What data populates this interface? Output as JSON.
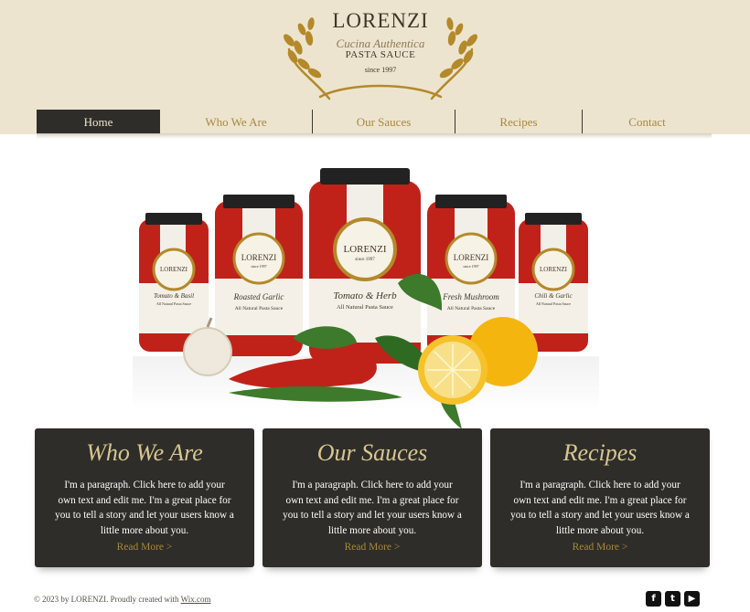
{
  "logo": {
    "brand": "LORENZI",
    "tagline": "Cucina Authentica",
    "product": "PASTA SAUCE",
    "since": "since 1997"
  },
  "nav": {
    "items": [
      {
        "label": "Home",
        "active": true
      },
      {
        "label": "Who We Are",
        "active": false
      },
      {
        "label": "Our Sauces",
        "active": false
      },
      {
        "label": "Recipes",
        "active": false
      },
      {
        "label": "Contact",
        "active": false
      }
    ]
  },
  "hero": {
    "jars": [
      {
        "brand": "LORENZI",
        "flavor": "Tomato & Basil"
      },
      {
        "brand": "LORENZI",
        "flavor": "Roasted Garlic"
      },
      {
        "brand": "LORENZI",
        "flavor": "Tomato & Herb"
      },
      {
        "brand": "LORENZI",
        "flavor": "Fresh Mushroom"
      },
      {
        "brand": "LORENZI",
        "flavor": "Chili & Garlic"
      }
    ],
    "jar_subtitle": "All Natural Pasta Sauce",
    "jar_since": "since 1997"
  },
  "cards": [
    {
      "title": "Who We Are",
      "text": "I'm a paragraph. Click here to add your own text and edit me. I'm a great place for you to tell a story and let your users know a little more about you.",
      "link": "Read More >"
    },
    {
      "title": "Our Sauces",
      "text": "I'm a paragraph. Click here to add your own text and edit me. I'm a great place for you to tell a story and let your users know a little more about you.",
      "link": "Read More >"
    },
    {
      "title": "Recipes",
      "text": "I'm a paragraph. Click here to add your own text and edit me. I'm a great place for you to tell a story and let your users know a little more about you.",
      "link": "Read More >"
    }
  ],
  "footer": {
    "copyright": "© 2023 by LORENZI. Proudly created with ",
    "link": "Wix.com"
  },
  "social": [
    {
      "icon": "facebook-icon",
      "glyph": "f"
    },
    {
      "icon": "twitter-icon",
      "glyph": "t"
    },
    {
      "icon": "youtube-icon",
      "glyph": "▶"
    }
  ],
  "colors": {
    "header_bg": "#ede4d0",
    "dark": "#2e2d29",
    "gold": "#a8893a",
    "sauce_red": "#c0221a"
  }
}
